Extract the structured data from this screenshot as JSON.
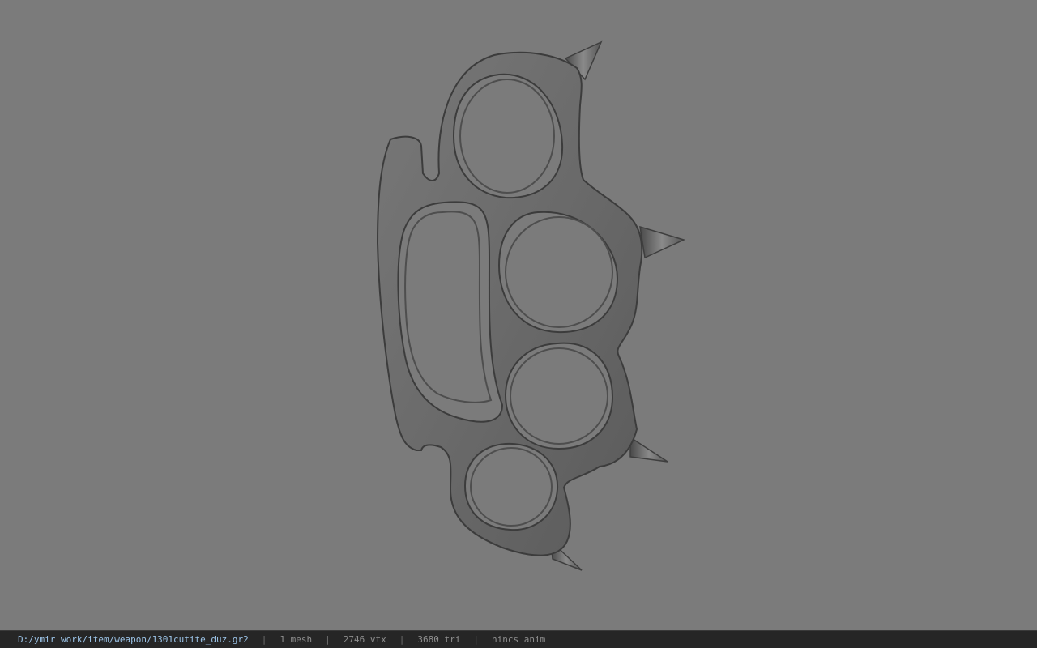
{
  "viewer": {
    "background_color": "#7b7b7b",
    "model_color": "#6a6a6a",
    "model_icon": "brass-knuckles-model"
  },
  "status_bar": {
    "file_path": "D:/ymir work/item/weapon/1301cutite_duz.gr2",
    "separator": "|",
    "mesh_count": "1 mesh",
    "vertex_count": "2746 vtx",
    "triangle_count": "3680 tri",
    "animation": "nincs anim"
  }
}
